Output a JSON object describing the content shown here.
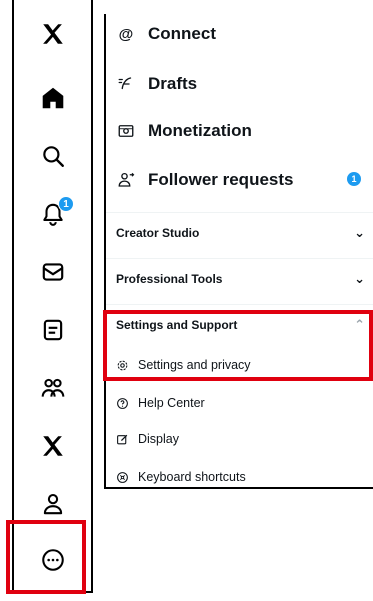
{
  "rail": {
    "icons": [
      "x-logo-icon",
      "home-icon",
      "search-icon",
      "notifications-icon",
      "messages-icon",
      "lists-icon",
      "communities-icon",
      "premium-x-icon",
      "profile-icon",
      "more-icon"
    ],
    "notification_count": "1"
  },
  "menu": {
    "items": [
      {
        "icon": "at-icon",
        "label": "Connect"
      },
      {
        "icon": "drafts-icon",
        "label": "Drafts"
      },
      {
        "icon": "monetization-icon",
        "label": "Monetization"
      },
      {
        "icon": "follower-requests-icon",
        "label": "Follower requests",
        "badge": "1"
      }
    ],
    "sections": [
      {
        "label": "Creator Studio",
        "state": "collapsed"
      },
      {
        "label": "Professional Tools",
        "state": "collapsed"
      },
      {
        "label": "Settings and Support",
        "state": "expanded"
      }
    ],
    "settings_items": [
      {
        "icon": "gear-icon",
        "label": "Settings and privacy"
      },
      {
        "icon": "help-icon",
        "label": "Help Center"
      },
      {
        "icon": "display-icon",
        "label": "Display"
      },
      {
        "icon": "keyboard-icon",
        "label": "Keyboard shortcuts"
      }
    ]
  },
  "colors": {
    "highlight": "#e0000f",
    "accent": "#1d9bf0",
    "text": "#0f1419"
  }
}
